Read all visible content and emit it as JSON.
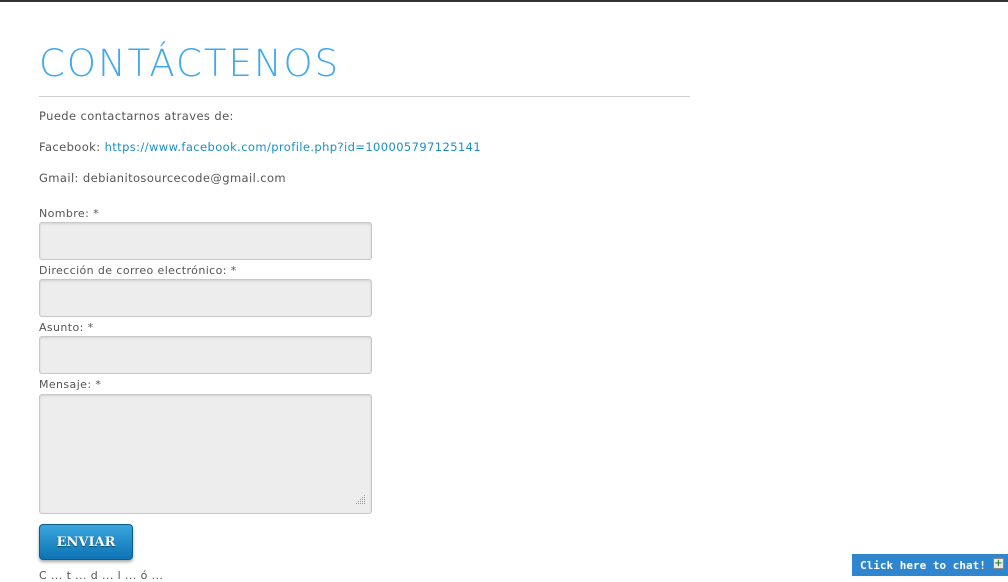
{
  "page": {
    "title": "CONTÁCTENOS"
  },
  "contact": {
    "intro": "Puede contactarnos atraves de:",
    "facebook_label": "Facebook:",
    "facebook_url": "https://www.facebook.com/profile.php?id=100005797125141",
    "gmail_label": "Gmail:",
    "gmail_value": "debianitosourcecode@gmail.com"
  },
  "form": {
    "name_label": "Nombre: *",
    "name_value": "",
    "email_label": "Dirección de correo electrónico: *",
    "email_value": "",
    "subject_label": "Asunto: *",
    "subject_value": "",
    "message_label": "Mensaje: *",
    "message_value": "",
    "submit_label": "ENVIAR"
  },
  "footer": {
    "truncated_text": "C  ...  t  ...  d  ...  l  ...  ó  ..."
  },
  "chat": {
    "label": "Click here to chat!",
    "icon": "plus-icon"
  },
  "colors": {
    "title": "#3fa9ec",
    "link": "#1a8fc8",
    "button": "#0d73b4",
    "chat_bar": "#2f86cf"
  }
}
